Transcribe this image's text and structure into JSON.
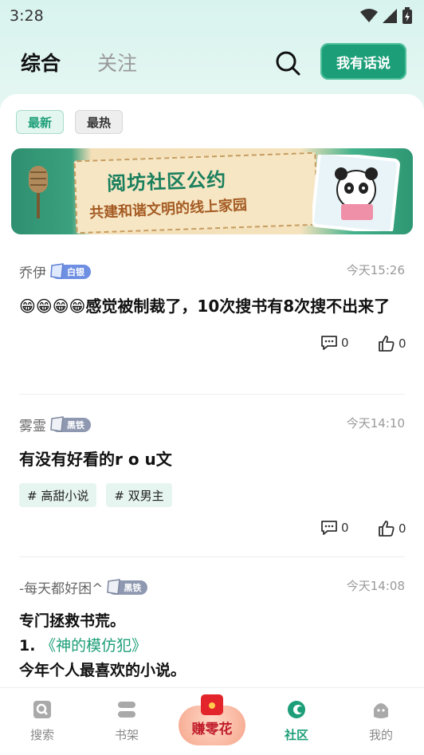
{
  "status": {
    "time": "3:28"
  },
  "header": {
    "tabs": [
      {
        "label": "综合"
      },
      {
        "label": "关注"
      }
    ],
    "speak_button": "我有话说"
  },
  "filters": [
    {
      "label": "最新"
    },
    {
      "label": "最热"
    }
  ],
  "banner": {
    "title": "阅坊社区公约",
    "subtitle": "共建和谐文明的线上家园"
  },
  "posts": [
    {
      "author": "乔伊",
      "badge": "白银",
      "badge_color": "#6f8fe3",
      "time": "今天15:26",
      "body_emoji": "😁😁😁😁",
      "body": "感觉被制裁了，10次搜书有8次搜不出来了",
      "comments": "0",
      "likes": "0"
    },
    {
      "author": "雾霊",
      "badge": "黑铁",
      "badge_color": "#8e98b0",
      "time": "今天14:10",
      "body": "有没有好看的r o u文",
      "tags": [
        "# 高甜小说",
        "# 双男主"
      ],
      "comments": "0",
      "likes": "0"
    },
    {
      "author": "-每天都好困^",
      "badge": "黑铁",
      "badge_color": "#8e98b0",
      "time": "今天14:08",
      "line1": "专门拯救书荒。",
      "line2_prefix": "1. ",
      "line2_link": "《神的模仿犯》",
      "line3": "今年个人最喜欢的小说。"
    }
  ],
  "bottom_nav": {
    "items": [
      {
        "label": "搜索"
      },
      {
        "label": "书架"
      },
      {
        "label": "赚零花"
      },
      {
        "label": "社区"
      },
      {
        "label": "我的"
      }
    ]
  },
  "colors": {
    "accent": "#1c9e78"
  }
}
